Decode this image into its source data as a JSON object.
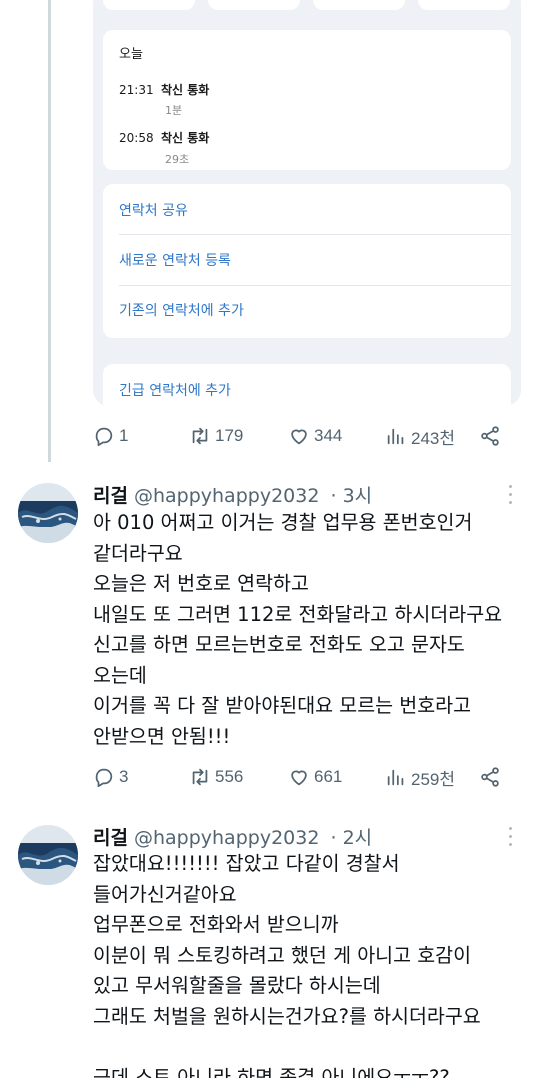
{
  "embed": {
    "calls_section_title": "오늘",
    "calls": [
      {
        "time": "21:31",
        "type": "착신 통화",
        "duration": "1분"
      },
      {
        "time": "20:58",
        "type": "착신 통화",
        "duration": "29초"
      }
    ],
    "actions": [
      "연락처 공유",
      "새로운 연락처 등록",
      "기존의 연락처에 추가"
    ],
    "emergency_action": "긴급 연락처에 추가"
  },
  "tweet0": {
    "stats": {
      "replies": "1",
      "retweets": "179",
      "likes": "344",
      "views": "243천"
    }
  },
  "tweet1": {
    "name": "리걸",
    "handle": "@happyhappy2032",
    "time": "· 3시",
    "lines": [
      "아 010 어쩌고 이거는 경찰 업무용 폰번호인거",
      "같더라구요",
      "오늘은 저 번호로 연락하고",
      "내일도 또 그러면 112로 전화달라고 하시더라구요",
      "신고를 하면 모르는번호로 전화도 오고 문자도",
      "오는데",
      "이거를 꼭 다 잘 받아야된대요 모르는 번호라고",
      "안받으면 안됨!!!"
    ],
    "stats": {
      "replies": "3",
      "retweets": "556",
      "likes": "661",
      "views": "259천"
    }
  },
  "tweet2": {
    "name": "리걸",
    "handle": "@happyhappy2032",
    "time": "· 2시",
    "lines": [
      "잡았대요!!!!!!! 잡았고 다같이 경찰서",
      "들어가신거같아요",
      "업무폰으로 전화와서 받으니까",
      "이분이 뭐 스토킹하려고 했던 게 아니고 호감이",
      "있고 무서워할줄을 몰랐다 하시는데",
      "그래도 처벌을 원하시는건가요?를 하시더라구요",
      "",
      "근데 스토 아니라 하면 좀결 아니에요ㅜㅜ??"
    ]
  },
  "colors": {
    "link_blue": "#2f77c8",
    "icon_gray": "#536471",
    "text": "#0f1419"
  },
  "icons": [
    "reply-icon",
    "retweet-icon",
    "like-icon",
    "views-icon",
    "share-icon",
    "more-icon"
  ]
}
